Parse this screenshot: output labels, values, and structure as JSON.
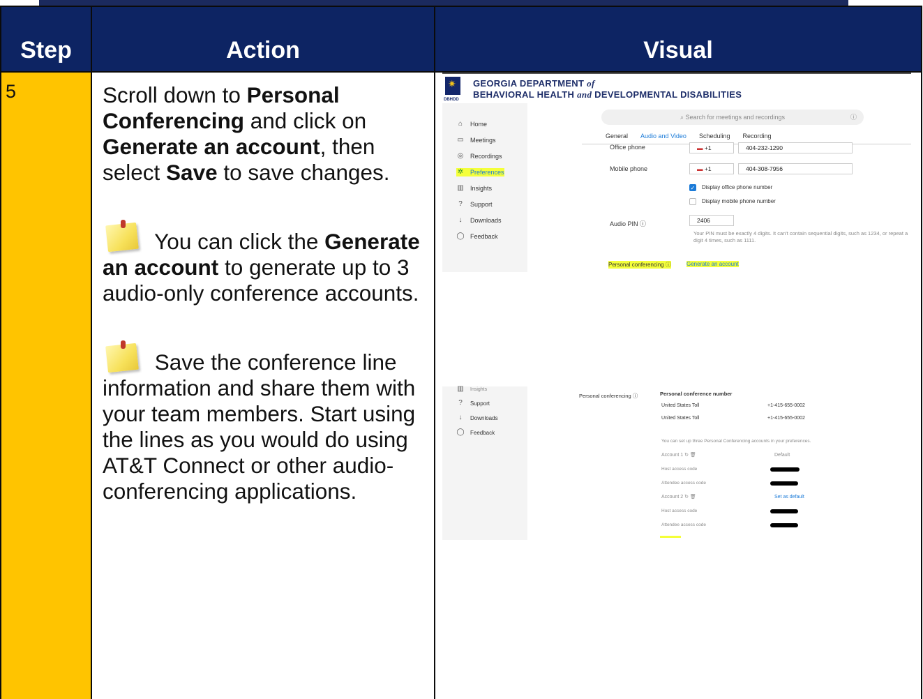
{
  "table": {
    "headers": {
      "step": "Step",
      "action": "Action",
      "visual": "Visual"
    },
    "row": {
      "step": "5",
      "action": {
        "p1_a": "Scroll down to ",
        "p1_b": "Personal Conferencing",
        "p1_c": " and click on ",
        "p1_d": "Generate an account",
        "p1_e": ", then select ",
        "p1_f": "Save",
        "p1_g": " to save changes.",
        "note1_a": " You can click the ",
        "note1_b": "Generate an account",
        "note1_c": " to generate up to 3 audio-only conference accounts.",
        "note2": " Save the conference line information and share them with your team members. Start using the lines as you would do using AT&T Connect or other audio-conferencing applications."
      }
    }
  },
  "screenshot1": {
    "org_line1_a": "GEORGIA DEPARTMENT ",
    "org_line1_b": "of",
    "org_line2_a": "BEHAVIORAL HEALTH ",
    "org_line2_b": "and",
    "org_line2_c": " DEVELOPMENTAL DISABILITIES",
    "seal_text": "DBHDD",
    "search_placeholder": "Search for meetings and recordings",
    "sidebar": [
      "Home",
      "Meetings",
      "Recordings",
      "Preferences",
      "Insights",
      "Support",
      "Downloads",
      "Feedback"
    ],
    "tabs": [
      "General",
      "Audio and Video",
      "Scheduling",
      "Recording"
    ],
    "office_phone_label": "Office phone",
    "office_code": "+1",
    "office_phone": "404-232-1290",
    "mobile_phone_label": "Mobile phone",
    "mobile_code": "+1",
    "mobile_phone": "404-308-7956",
    "display_office": "Display office phone number",
    "display_mobile": "Display mobile phone number",
    "audio_pin_label": "Audio PIN",
    "audio_pin": "2406",
    "pin_help": "Your PIN must be exactly 4 digits. It can't contain sequential digits, such as 1234, or repeat a digit 4 times, such as 1111.",
    "personal_conf_label": "Personal conferencing",
    "generate_link": "Generate an account"
  },
  "screenshot2": {
    "sidebar": [
      "Insights",
      "Support",
      "Downloads",
      "Feedback"
    ],
    "personal_conf_label": "Personal conferencing",
    "number_header": "Personal conference number",
    "toll1_label": "United States Toll",
    "toll1": "+1-415-655-0002",
    "toll2_label": "United States Toll",
    "toll2": "+1-415-655-0002",
    "setup_note": "You can set up three Personal Conferencing accounts in your preferences.",
    "account1": "Account 1",
    "default_label": "Default",
    "host_code": "Host access code",
    "attendee_code": "Attendee access code",
    "account2": "Account 2",
    "set_default": "Set as default",
    "host_code2": "Host access code",
    "attendee_code2": "Attendee access code"
  },
  "colors": {
    "header_bg": "#0d2463",
    "step_bg": "#ffc400",
    "highlight": "#f4ff3a",
    "link_blue": "#1b7bd8"
  }
}
